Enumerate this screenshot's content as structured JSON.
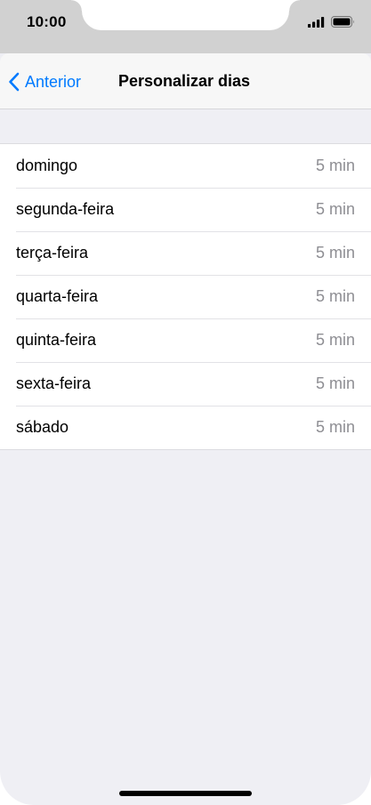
{
  "status_bar": {
    "time": "10:00"
  },
  "nav": {
    "back_label": "Anterior",
    "title": "Personalizar dias"
  },
  "days": [
    {
      "label": "domingo",
      "value": "5 min"
    },
    {
      "label": "segunda-feira",
      "value": "5 min"
    },
    {
      "label": "terça-feira",
      "value": "5 min"
    },
    {
      "label": "quarta-feira",
      "value": "5 min"
    },
    {
      "label": "quinta-feira",
      "value": "5 min"
    },
    {
      "label": "sexta-feira",
      "value": "5 min"
    },
    {
      "label": "sábado",
      "value": "5 min"
    }
  ],
  "colors": {
    "accent": "#007aff",
    "background": "#efeff4",
    "secondary_text": "#8e8e93"
  },
  "icons": [
    "signal-icon",
    "battery-icon",
    "chevron-left-icon"
  ]
}
